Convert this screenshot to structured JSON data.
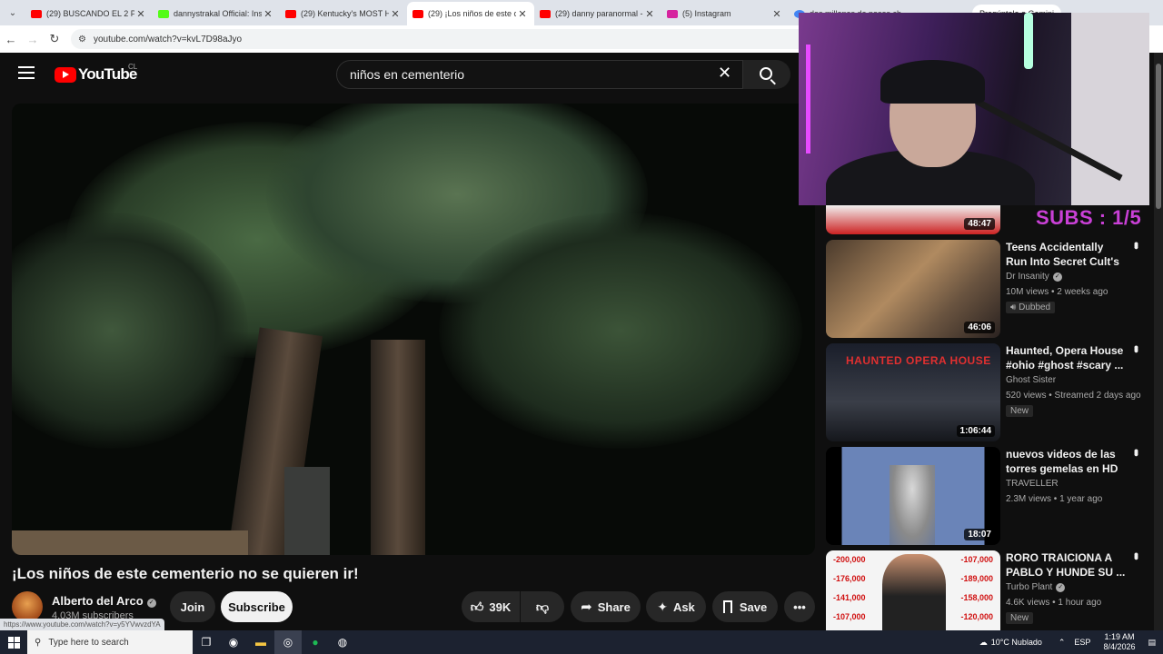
{
  "browser": {
    "tabs": [
      {
        "title": "(29) BUSCANDO EL 2 PA 2",
        "color": "#ff0000",
        "active": false
      },
      {
        "title": "dannystrakal Official: Insta",
        "color": "#53fc18",
        "active": false
      },
      {
        "title": "(29) Kentucky's MOST HAU",
        "color": "#ff0000",
        "active": false
      },
      {
        "title": "(29) ¡Los niños de este cem",
        "color": "#ff0000",
        "active": true
      },
      {
        "title": "(29) danny paranormal - Y",
        "color": "#ff0000",
        "active": false
      },
      {
        "title": "(5) Instagram",
        "color": "#d6249f",
        "active": false
      },
      {
        "title": "dos millones de pesos ch",
        "color": "#4285f4",
        "active": false
      }
    ],
    "gemini_label": "Pregúntale a Gemini",
    "url": "youtube.com/watch?v=kvL7D98aJyo"
  },
  "yt": {
    "country": "CL",
    "search_value": "niños en cementerio",
    "video_title": "¡Los niños de este cementerio no se quieren ir!",
    "channel": "Alberto del Arco",
    "subscribers": "4.03M subscribers",
    "join_label": "Join",
    "subscribe_label": "Subscribe",
    "likes": "39K",
    "share_label": "Share",
    "ask_label": "Ask",
    "save_label": "Save",
    "status_url": "https://www.youtube.com/watch?v=y5YVwvzdYA"
  },
  "overlay": {
    "subs_text": "SUBS : 1/5"
  },
  "recommendations": [
    {
      "duration": "48:47",
      "title": "",
      "channel": "",
      "meta": "",
      "badge": ""
    },
    {
      "duration": "46:06",
      "title": "Teens Accidentally Run Into Secret Cult's Body ...",
      "channel": "Dr Insanity",
      "verified": true,
      "meta": "10M views • 2 weeks ago",
      "badge": "Dubbed"
    },
    {
      "duration": "1:06:44",
      "title": "Haunted, Opera House #ohio #ghost #scary ...",
      "channel": "Ghost Sister",
      "verified": false,
      "meta": "520 views • Streamed 2 days ago",
      "badge": "New",
      "thumb_text": "HAUNTED OPERA HOUSE"
    },
    {
      "duration": "18:07",
      "title": "nuevos videos de las torres gemelas en HD ...",
      "channel": "TRAVELLER",
      "verified": false,
      "meta": "2.3M views • 1 year ago",
      "badge": ""
    },
    {
      "duration": "",
      "title": "RORO TRAICIONA A PABLO Y HUNDE SU ...",
      "channel": "Turbo Plant",
      "verified": true,
      "meta": "4.6K views • 1 hour ago",
      "badge": "New",
      "thumb_left": [
        "-200,000",
        "-176,000",
        "-141,000",
        "-107,000"
      ],
      "thumb_right": [
        "-107,000",
        "-189,000",
        "-158,000",
        "-120,000"
      ]
    }
  ],
  "taskbar": {
    "search_placeholder": "Type here to search",
    "weather": "10°C  Nublado",
    "lang": "ESP",
    "time": "1:19 AM",
    "date": "8/4/2026"
  }
}
